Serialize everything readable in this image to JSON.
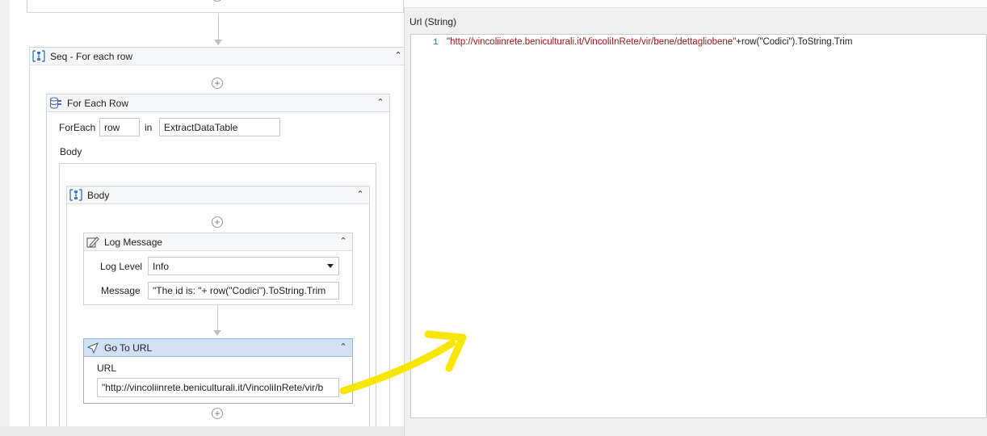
{
  "sequence": {
    "title": "Seq - For each row"
  },
  "for_each_row": {
    "title": "For Each Row",
    "foreach_label": "ForEach",
    "item_value": "row",
    "in_label": "in",
    "collection_value": "ExtractDataTable",
    "body_label": "Body"
  },
  "body_sequence": {
    "title": "Body"
  },
  "log_message": {
    "title": "Log Message",
    "level_label": "Log Level",
    "level_value": "Info",
    "message_label": "Message",
    "message_value": "\"The id is: \"+ row(\"Codici\").ToString.Trim"
  },
  "go_to_url": {
    "title": "Go To URL",
    "url_label": "URL",
    "url_value": "\"http://vincoliinrete.beniculturali.it/VincoliInRete/vir/b"
  },
  "expression_editor": {
    "title": "Url (String)",
    "line_number": "1",
    "code_string": "\"http://vincoliinrete.beniculturali.it/VincoliInRete/vir/bene/dettagliobene\"",
    "code_rest": "+row(\"Codici\").ToString.Trim"
  },
  "colors": {
    "selected_header": "#cfe1f3",
    "string_literal": "#a31515",
    "annotation": "#f7e600"
  },
  "icons": {
    "collapse": "double-chevron-up-icon",
    "sequence": "sequence-icon",
    "foreach": "database-rows-icon",
    "log": "log-pen-icon",
    "navigate": "navigate-arrow-icon",
    "add": "plus-circle-icon"
  }
}
